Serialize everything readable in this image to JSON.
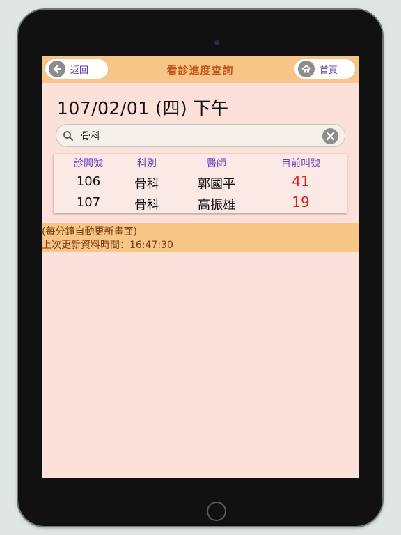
{
  "nav": {
    "back_label": "返回",
    "title": "看診進度查詢",
    "home_label": "首頁"
  },
  "date_line": "107/02/01 (四) 下午",
  "search": {
    "value": "骨科"
  },
  "table": {
    "headers": [
      "診間號",
      "科別",
      "醫師",
      "目前叫號"
    ],
    "rows": [
      [
        "106",
        "骨科",
        "郭國平",
        "41"
      ],
      [
        "107",
        "骨科",
        "高振雄",
        "19"
      ]
    ]
  },
  "info": {
    "auto_refresh": "(每分鐘自動更新畫面)",
    "last_update": "上次更新資料時間：16:47:30"
  },
  "colors": {
    "nav_bar": "#f7c585",
    "screen_bg": "#fce0da",
    "header_text": "#6a3dbf",
    "call_number": "#e01e1e",
    "title_text": "#c0561e"
  }
}
